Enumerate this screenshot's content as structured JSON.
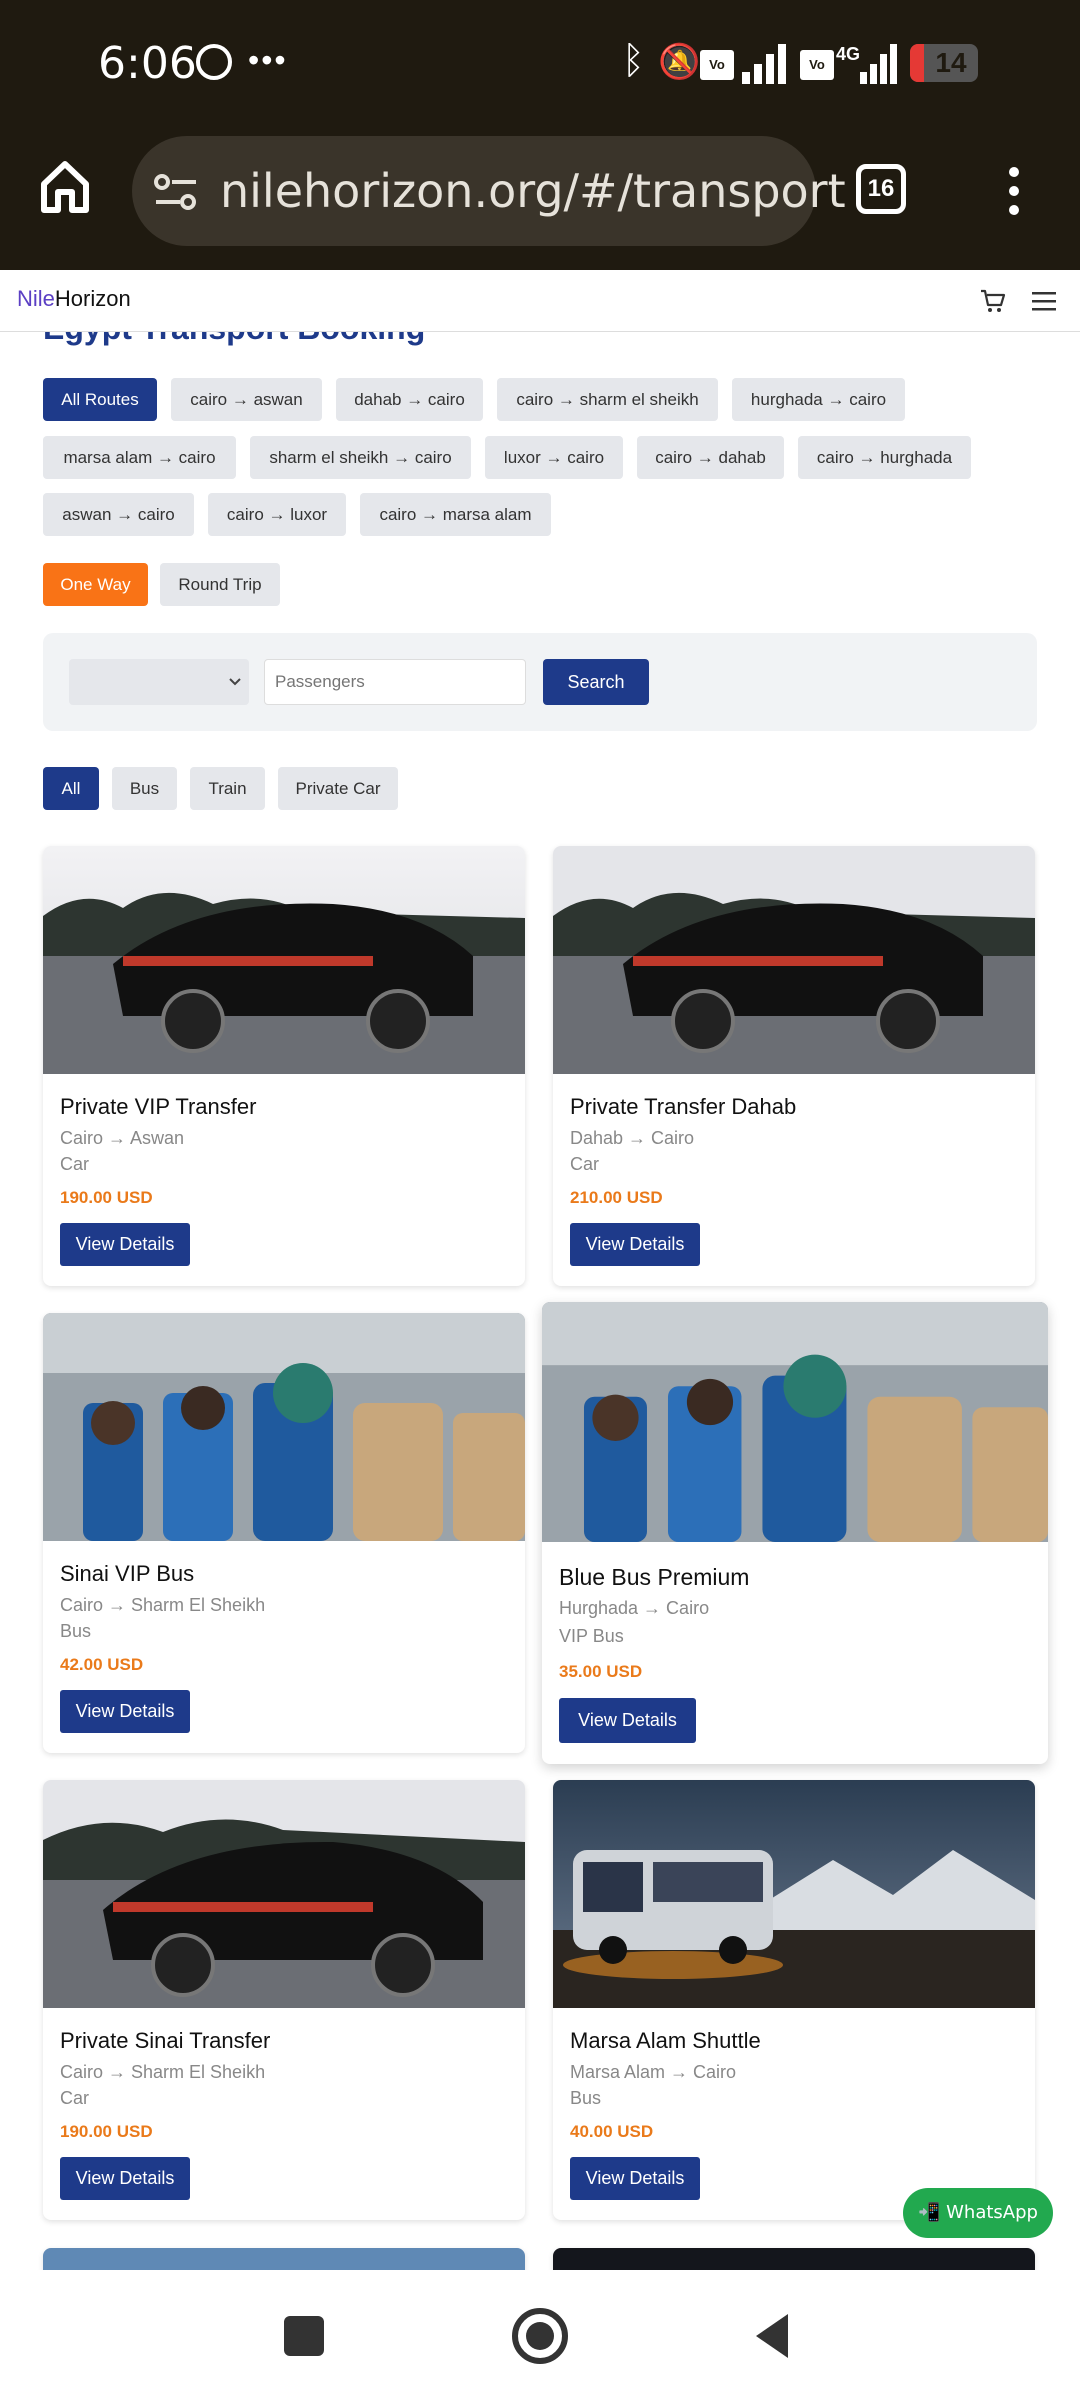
{
  "status": {
    "time": "6:06",
    "battery": "14"
  },
  "browser": {
    "url": "nilehorizon.org/#/transport",
    "tab_count": "16"
  },
  "site": {
    "logo_part1": "Nile",
    "logo_part2": "Horizon"
  },
  "page_title": "Egypt Transport Booking",
  "route_filters": [
    "All Routes",
    "cairo → aswan",
    "dahab → cairo",
    "cairo → sharm el sheikh",
    "hurghada → cairo",
    "marsa alam → cairo",
    "sharm el sheikh → cairo",
    "luxor → cairo",
    "cairo → dahab",
    "cairo → hurghada",
    "aswan → cairo",
    "cairo → luxor",
    "cairo → marsa alam"
  ],
  "trip_types": [
    "One Way",
    "Round Trip"
  ],
  "search": {
    "passengers_placeholder": "Passengers",
    "button": "Search"
  },
  "type_filters": [
    "All",
    "Bus",
    "Train",
    "Private Car"
  ],
  "cards": [
    {
      "title": "Private VIP Transfer",
      "route": "Cairo → Aswan",
      "type": "Car",
      "price": "190.00 USD",
      "button": "View Details"
    },
    {
      "title": "Private Transfer Dahab",
      "route": "Dahab → Cairo",
      "type": "Car",
      "price": "210.00 USD",
      "button": "View Details"
    },
    {
      "title": "Sinai VIP Bus",
      "route": "Cairo → Sharm El Sheikh",
      "type": "Bus",
      "price": "42.00 USD",
      "button": "View Details"
    },
    {
      "title": "Blue Bus Premium",
      "route": "Hurghada → Cairo",
      "type": "VIP Bus",
      "price": "35.00 USD",
      "button": "View Details"
    },
    {
      "title": "Private Sinai Transfer",
      "route": "Cairo → Sharm El Sheikh",
      "type": "Car",
      "price": "190.00 USD",
      "button": "View Details"
    },
    {
      "title": "Marsa Alam Shuttle",
      "route": "Marsa Alam → Cairo",
      "type": "Bus",
      "price": "40.00 USD",
      "button": "View Details"
    }
  ],
  "whatsapp_label": "📲 WhatsApp",
  "colors": {
    "primary": "#1e3a8a",
    "accent": "#f97316",
    "price": "#ea7a1a",
    "whatsapp": "#22a94f"
  }
}
